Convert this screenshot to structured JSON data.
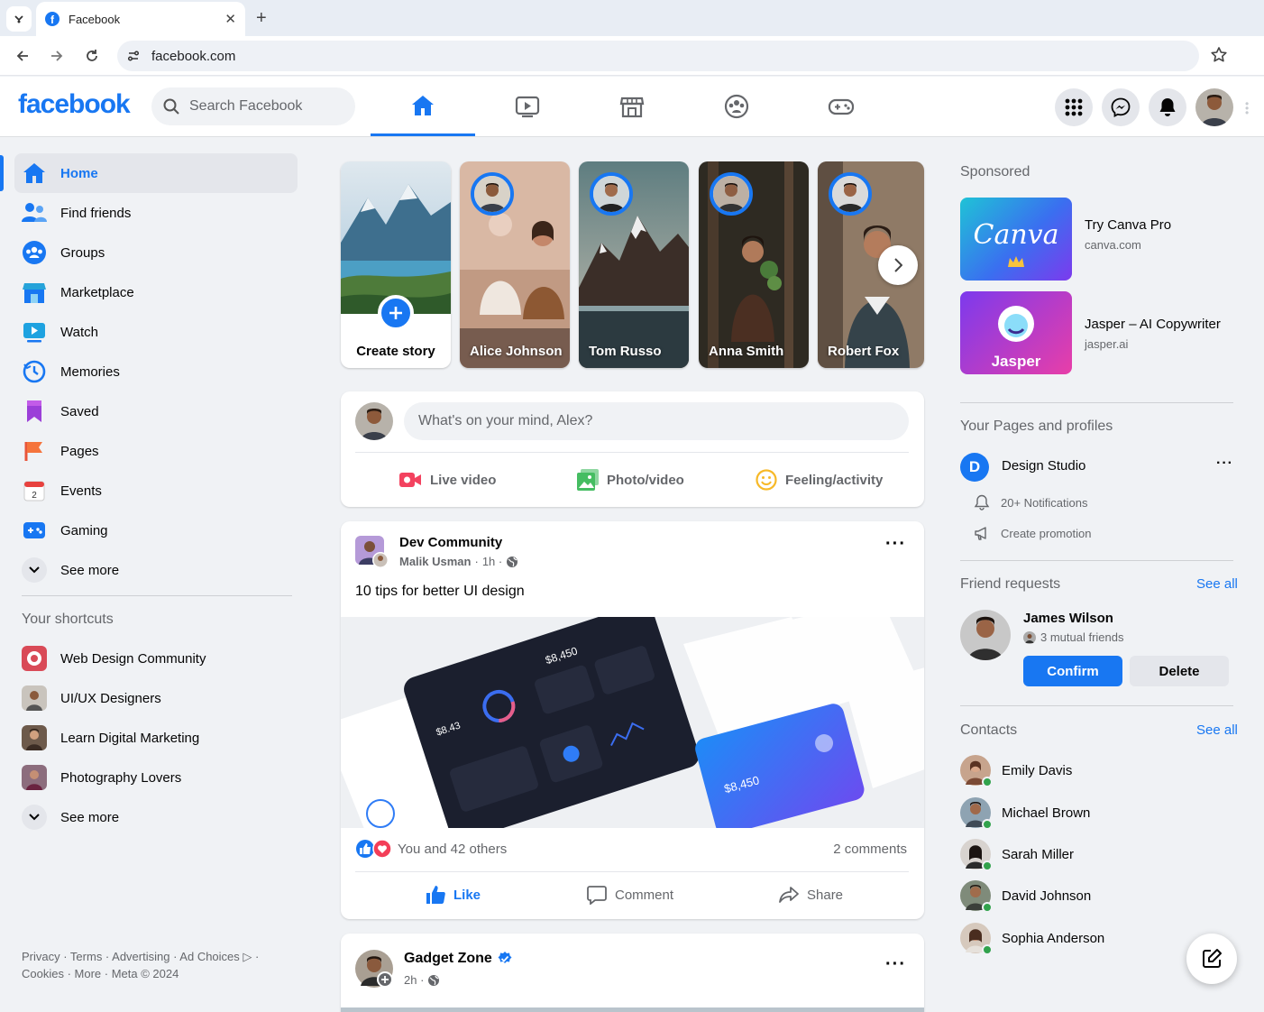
{
  "browser": {
    "tab_title": "Facebook",
    "url": "facebook.com",
    "new_tab": "+",
    "close_tab": "✕"
  },
  "header": {
    "logo": "facebook",
    "search_placeholder": "Search Facebook",
    "nav": [
      "home-icon",
      "watch-icon",
      "marketplace-icon",
      "groups-icon",
      "gaming-icon"
    ],
    "active_nav": "home",
    "right_icons": [
      "menu-grid-icon",
      "messenger-icon",
      "bell-icon",
      "avatar"
    ]
  },
  "sidebar": {
    "items": [
      {
        "label": "Home",
        "icon": "home-icon"
      },
      {
        "label": "Find friends",
        "icon": "friends-icon"
      },
      {
        "label": "Groups",
        "icon": "groups-icon"
      },
      {
        "label": "Marketplace",
        "icon": "marketplace-icon"
      },
      {
        "label": "Watch",
        "icon": "watch-icon"
      },
      {
        "label": "Memories",
        "icon": "memories-icon"
      },
      {
        "label": "Saved",
        "icon": "saved-icon"
      },
      {
        "label": "Pages",
        "icon": "pages-icon"
      },
      {
        "label": "Events",
        "icon": "events-icon"
      },
      {
        "label": "Gaming",
        "icon": "gaming-icon"
      },
      {
        "label": "See more",
        "icon": "chevron-down-icon"
      }
    ],
    "shortcuts_heading": "Your shortcuts",
    "shortcuts": [
      {
        "label": "Web Design Community"
      },
      {
        "label": "UI/UX Designers"
      },
      {
        "label": "Learn Digital Marketing"
      },
      {
        "label": "Photography Lovers"
      },
      {
        "label": "See more"
      }
    ],
    "footer_line1": "Privacy · Terms · Advertising · Ad Choices ▷ ·",
    "footer_line2": "Cookies · More · Meta © 2024"
  },
  "stories": [
    {
      "name": "Create story"
    },
    {
      "name": "Alice Johnson"
    },
    {
      "name": "Tom Russo"
    },
    {
      "name": "Anna Smith"
    },
    {
      "name": "Robert Fox"
    }
  ],
  "composer": {
    "placeholder": "What's on your mind, Alex?",
    "actions": [
      {
        "label": "Live video",
        "icon": "live-video-icon",
        "color": "#f3425f"
      },
      {
        "label": "Photo/video",
        "icon": "photo-icon",
        "color": "#45bd62"
      },
      {
        "label": "Feeling/activity",
        "icon": "feeling-icon",
        "color": "#f7b928"
      }
    ]
  },
  "posts": [
    {
      "group": "Dev Community",
      "author": "Malik Usman",
      "time": "1h ·",
      "text": "10 tips for better UI design",
      "image_texts": {
        "balance": "$8,450",
        "metric": "$8.43",
        "card": "$8,450"
      },
      "reactions": "You and 42 others",
      "comments": "2 comments",
      "actions": [
        "Like",
        "Comment",
        "Share"
      ]
    },
    {
      "group": "Gadget Zone",
      "time": "2h ·",
      "verified": true
    }
  ],
  "right": {
    "sponsored_heading": "Sponsored",
    "ads": [
      {
        "title": "Try Canva Pro",
        "url": "canva.com",
        "logo": "Canva"
      },
      {
        "title": "Jasper – AI Copywriter",
        "url": "jasper.ai",
        "logo": "Jasper"
      }
    ],
    "pages_heading": "Your Pages and profiles",
    "page": {
      "initial": "D",
      "name": "Design Studio",
      "notifications": "20+ Notifications",
      "promotion": "Create promotion"
    },
    "friend_requests_heading": "Friend requests",
    "see_all": "See all",
    "request": {
      "name": "James Wilson",
      "mutual": "3 mutual friends",
      "confirm": "Confirm",
      "delete": "Delete"
    },
    "contacts_heading": "Contacts",
    "contacts": [
      {
        "name": "Emily Davis"
      },
      {
        "name": "Michael Brown"
      },
      {
        "name": "Sarah Miller"
      },
      {
        "name": "David Johnson"
      },
      {
        "name": "Sophia Anderson"
      }
    ]
  },
  "colors": {
    "brand": "#1877f2",
    "background": "#f0f2f5",
    "online": "#31a24c"
  }
}
